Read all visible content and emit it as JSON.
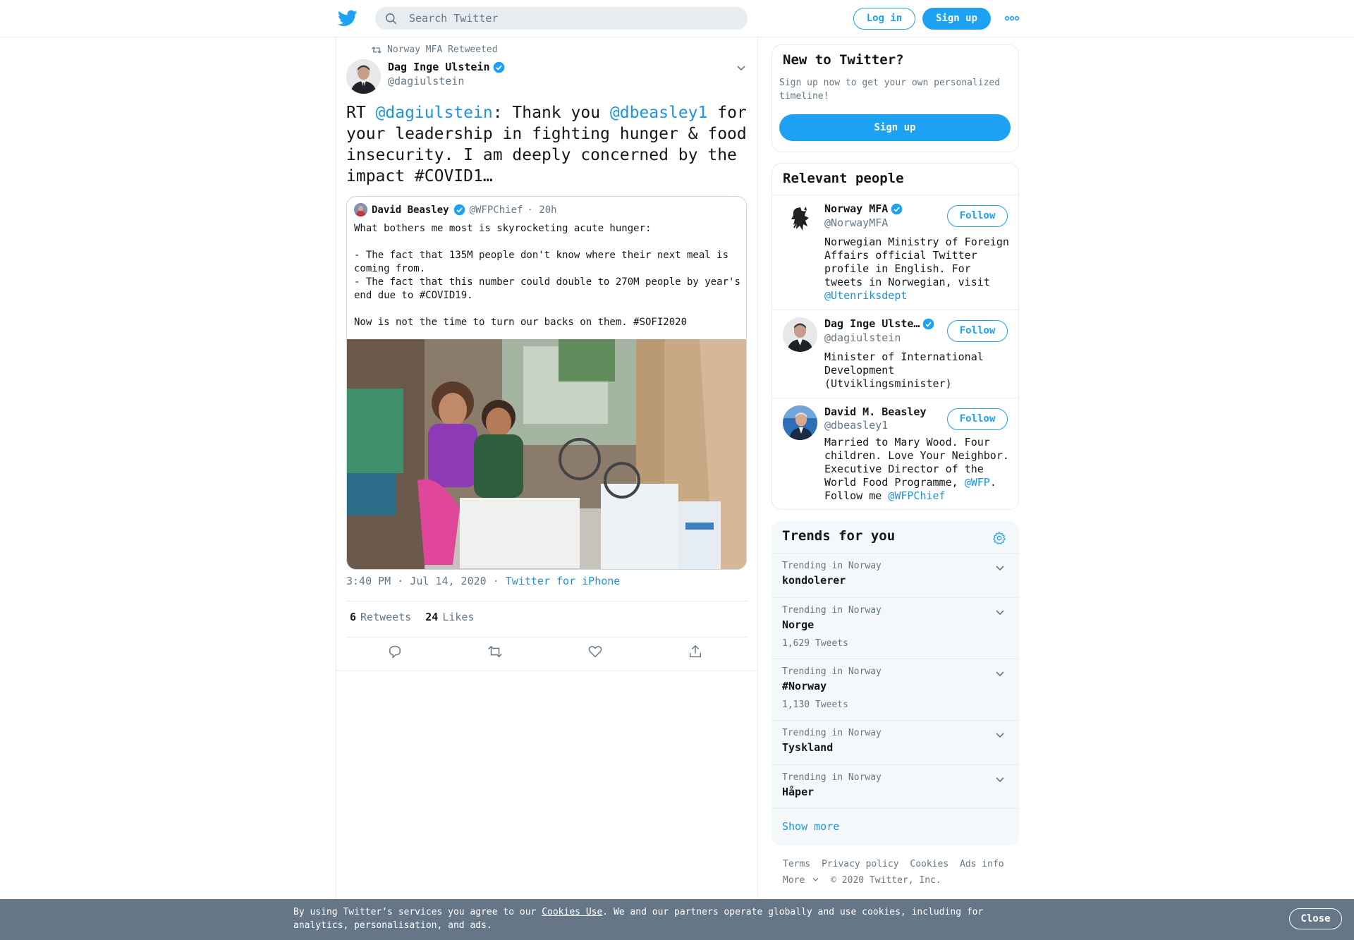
{
  "colors": {
    "accent": "#1da1f2",
    "link": "#1b95e0",
    "muted": "#657786",
    "cookie_bar": "#657786"
  },
  "header": {
    "search_placeholder": "Search Twitter",
    "login_label": "Log in",
    "signup_label": "Sign up",
    "logo_icon": "twitter-bird-icon",
    "more_icon": "more-dots-icon"
  },
  "tweet": {
    "retweet_context": "Norway MFA Retweeted",
    "author_name": "Dag Inge Ulstein",
    "author_handle": "@dagiulstein",
    "text_parts": {
      "p1": "RT ",
      "m1": "@dagiulstein",
      "p2": ": Thank you ",
      "m2": "@dbeasley1",
      "p3": " for your leadership in fighting hunger & food insecurity. I am deeply concerned by the impact #COVID1…"
    },
    "quote": {
      "author_name": "David Beasley",
      "author_handle": "@WFPChief",
      "time": "· 20h",
      "text": "What bothers me most is skyrocketing acute hunger:\n\n- The fact that 135M people don't know where their next meal is coming from.\n- The fact that this number could double to 270M people by year's end due to #COVID19.\n\nNow is not the time to turn our backs on them. #SOFI2020"
    },
    "timestamp": "3:40 PM · Jul 14, 2020",
    "meta_sep": "·",
    "source": "Twitter for iPhone",
    "retweets_count": "6",
    "retweets_label": "Retweets",
    "likes_count": "24",
    "likes_label": "Likes"
  },
  "sidebar": {
    "new_to_twitter": {
      "title": "New to Twitter?",
      "text": "Sign up now to get your own personalized timeline!",
      "button": "Sign up"
    },
    "relevant_people": {
      "title": "Relevant people",
      "follow_label": "Follow",
      "people": [
        {
          "name": "Norway MFA",
          "handle": "@NorwayMFA",
          "bio": "Norwegian Ministry of Foreign Affairs official Twitter profile in English. For tweets in Norwegian, visit ",
          "bio_link": "@Utenriksdept"
        },
        {
          "name": "Dag Inge Ulste…",
          "handle": "@dagiulstein",
          "bio": "Minister of International Development (Utviklingsminister)"
        },
        {
          "name": "David M. Beasley",
          "handle": "@dbeasley1",
          "bio": "Married to Mary Wood. Four children. Love Your Neighbor. Executive Director of the World Food Programme, ",
          "bio_link": "@WFP",
          "bio_mid": ". Follow me ",
          "bio_link2": "@WFPChief"
        }
      ]
    },
    "trends": {
      "title": "Trends for you",
      "items": [
        {
          "context": "Trending in Norway",
          "name": "kondolerer",
          "count": ""
        },
        {
          "context": "Trending in Norway",
          "name": "Norge",
          "count": "1,629 Tweets"
        },
        {
          "context": "Trending in Norway",
          "name": "#Norway",
          "count": "1,130 Tweets"
        },
        {
          "context": "Trending in Norway",
          "name": "Tyskland",
          "count": ""
        },
        {
          "context": "Trending in Norway",
          "name": "Håper",
          "count": ""
        }
      ],
      "show_more": "Show more"
    },
    "footer": {
      "links": [
        "Terms",
        "Privacy policy",
        "Cookies",
        "Ads info"
      ],
      "more": "More",
      "copyright": "© 2020 Twitter, Inc."
    }
  },
  "cookie_bar": {
    "text_before": "By using Twitter’s services you agree to our ",
    "link": "Cookies Use",
    "text_after": ". We and our partners operate globally and use cookies, including for analytics, personalisation, and ads.",
    "close_label": "Close"
  }
}
